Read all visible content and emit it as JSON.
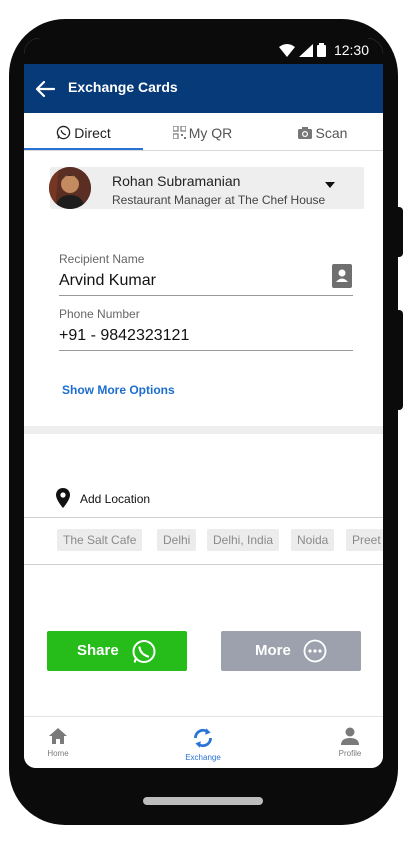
{
  "status_bar": {
    "time": "12:30"
  },
  "app_bar": {
    "title": "Exchange Cards"
  },
  "tabs": [
    {
      "label": "Direct",
      "icon": "whatsapp-icon"
    },
    {
      "label": "My QR",
      "icon": "qr-icon"
    },
    {
      "label": "Scan",
      "icon": "camera-icon"
    }
  ],
  "profile": {
    "name": "Rohan Subramanian",
    "role": "Restaurant Manager at The Chef House"
  },
  "form": {
    "recipient_label": "Recipient Name",
    "recipient_value": "Arvind Kumar",
    "phone_label": "Phone Number",
    "phone_value": "+91 - 9842323121",
    "more_options": "Show More Options"
  },
  "location": {
    "label": "Add Location",
    "chips": [
      "The Salt Cafe",
      "Delhi",
      "Delhi, India",
      "Noida",
      "Preet"
    ]
  },
  "actions": {
    "share_label": "Share",
    "more_label": "More"
  },
  "bottom_nav": [
    {
      "label": "Home",
      "icon": "home-icon"
    },
    {
      "label": "Exchange",
      "icon": "sync-icon"
    },
    {
      "label": "Profile",
      "icon": "person-icon"
    }
  ],
  "colors": {
    "app_bar": "#073a78",
    "accent": "#2a73d6",
    "share_button": "#26bd1b",
    "more_button": "#9da1ad"
  }
}
